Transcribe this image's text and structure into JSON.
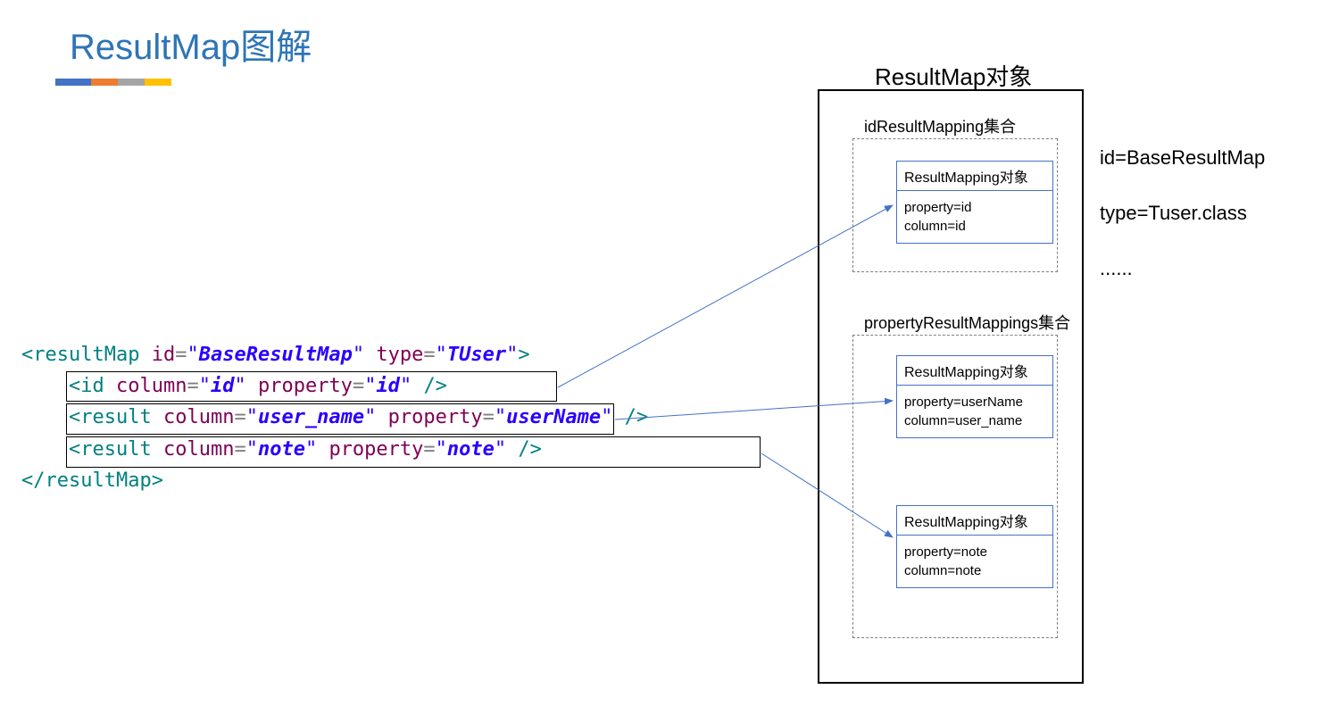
{
  "title": "ResultMap图解",
  "code": {
    "open_tag": "resultMap",
    "id_attr": "id",
    "id_val": "BaseResultMap",
    "type_attr": "type",
    "type_val": "TUser",
    "line_id": {
      "tag": "id",
      "col_attr": "column",
      "col_val": "id",
      "prop_attr": "property",
      "prop_val": "id"
    },
    "line_r1": {
      "tag": "result",
      "col_attr": "column",
      "col_val": "user_name",
      "prop_attr": "property",
      "prop_val": "userName"
    },
    "line_r2": {
      "tag": "result",
      "col_attr": "column",
      "col_val": "note",
      "prop_attr": "property",
      "prop_val": "note"
    },
    "close_tag": "resultMap"
  },
  "obj_label": "ResultMap对象",
  "id_collection_label": "idResultMapping集合",
  "prop_collection_label": "propertyResultMappings集合",
  "mapping_header": "ResultMapping对象",
  "m1": {
    "l1": "property=id",
    "l2": "column=id"
  },
  "m2": {
    "l1": "property=userName",
    "l2": "column=user_name"
  },
  "m3": {
    "l1": "property=note",
    "l2": "column=note"
  },
  "side": {
    "l1": "id=BaseResultMap",
    "l2": "type=Tuser.class",
    "l3": "......"
  }
}
